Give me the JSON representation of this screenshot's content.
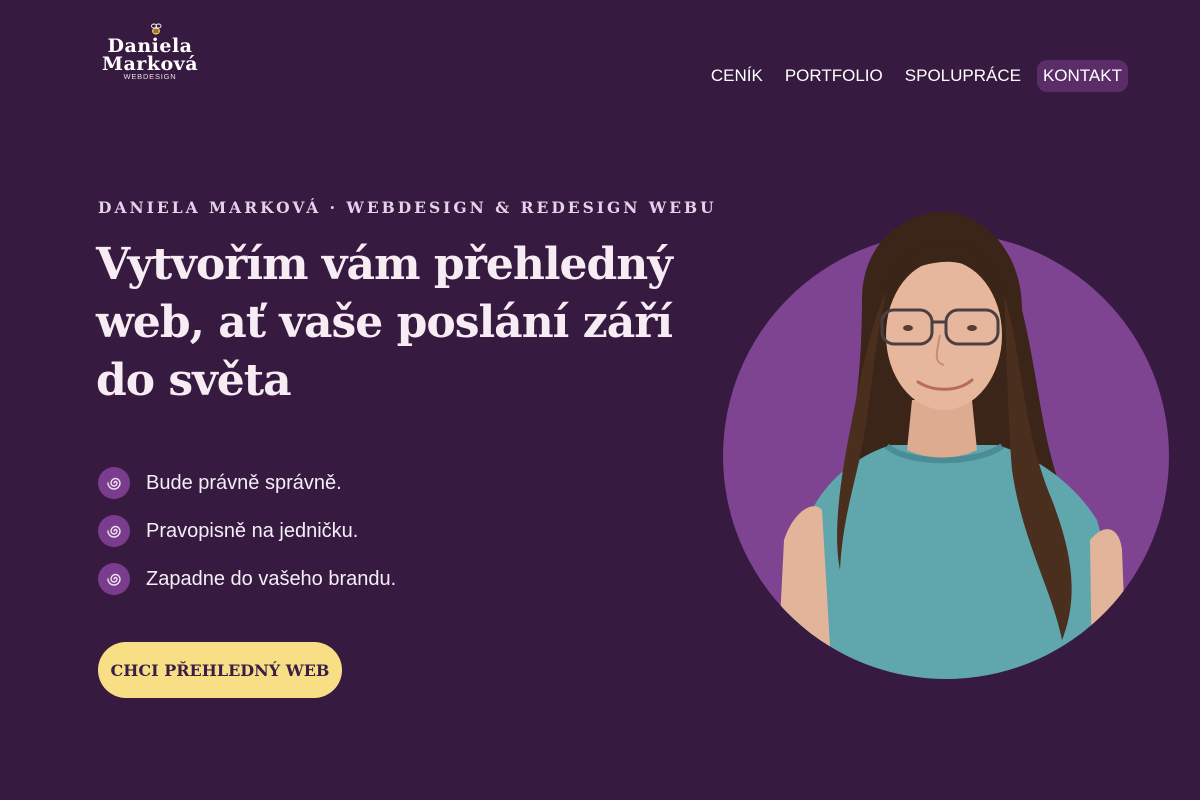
{
  "logo": {
    "line1": "Daniela",
    "line2": "Marková",
    "sub": "WEBDESIGN",
    "icon": "bee-icon"
  },
  "nav": {
    "items": [
      {
        "label": "CENÍK"
      },
      {
        "label": "PORTFOLIO"
      },
      {
        "label": "SPOLUPRÁCE"
      },
      {
        "label": "KONTAKT",
        "active": true
      }
    ]
  },
  "hero": {
    "kicker": "DANIELA MARKOVÁ · WEBDESIGN & REDESIGN WEBU",
    "headline": "Vytvořím vám přehledný web, ať vaše poslání září do světa",
    "bullets": [
      {
        "text": "Bude právně správně.",
        "icon": "spiral-icon"
      },
      {
        "text": "Pravopisně na jedničku.",
        "icon": "spiral-icon"
      },
      {
        "text": "Zapadne do vašeho brandu.",
        "icon": "spiral-icon"
      }
    ],
    "cta_label": "CHCI PŘEHLEDNÝ WEB"
  },
  "colors": {
    "background": "#371a40",
    "accent_purple": "#7e4391",
    "cta_yellow": "#f8df86",
    "nav_active": "#5a2d68"
  }
}
